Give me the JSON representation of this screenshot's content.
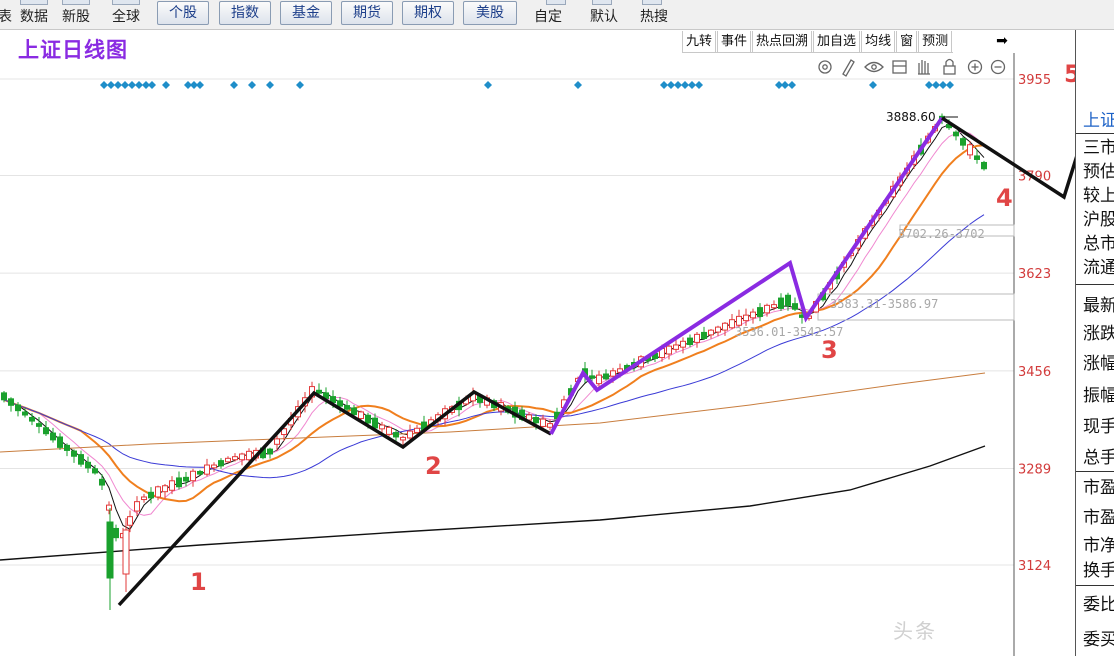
{
  "toolbar": {
    "labels": [
      "表",
      "数据",
      "新股",
      "全球"
    ],
    "buttons": [
      "个股",
      "指数",
      "基金",
      "期货",
      "期权",
      "美股"
    ],
    "right_labels": [
      "自定",
      "默认",
      "热搜"
    ]
  },
  "chart_tools": [
    "九转",
    "事件",
    "热点回溯",
    "加自选",
    "均线",
    "窗",
    "预测"
  ],
  "chart_title": "上证日线图",
  "price_axis": [
    "3955",
    "3790",
    "3623",
    "3456",
    "3289",
    "3124"
  ],
  "annotations": {
    "high_price": "3888.60",
    "gap1": "3702.26-3702",
    "gap2": "3583.31-3586.97",
    "gap3": "3536.01-3542.57",
    "wave_labels": [
      "1",
      "2",
      "3",
      "4",
      "5"
    ],
    "corner_label": "3"
  },
  "right_panel": {
    "items": [
      "上证",
      "三市",
      "预估",
      "较上",
      "沪股",
      "总市",
      "流通",
      "最新",
      "涨跌",
      "涨幅",
      "振幅",
      "现手",
      "总手",
      "市盈",
      "市盈",
      "市净",
      "换手",
      "委比",
      "委买"
    ]
  },
  "watermark": "头条",
  "colors": {
    "up": "#e23a3a",
    "down": "#1aa12d",
    "title": "#8a2be2",
    "diamond": "#1f8ec9",
    "ma5": "#111111",
    "ma10": "#f088d0",
    "ma20": "#f07f1e",
    "ma60": "#3b3bd6",
    "ma120": "#c87d3e",
    "ma250": "#111111"
  }
}
